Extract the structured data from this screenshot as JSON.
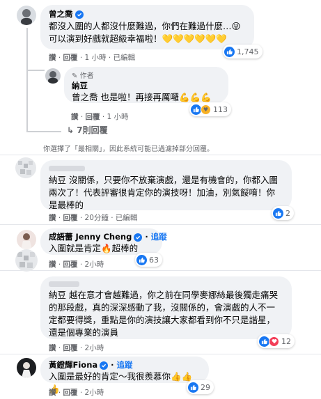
{
  "comments": [
    {
      "author": "曾之喬",
      "text": "都沒入圍的人都沒什麼難過，你們在難過什麼…😜 可以演到好戲就超級幸福啦！💛💛💛💛💛💛",
      "actions": {
        "like": "讚",
        "reply": "回覆",
        "time": "1 小時",
        "edited": "已編輯"
      },
      "reaction_count": "1,745"
    },
    {
      "author_badge": "作者",
      "author": "納豆",
      "text": "曾之喬 也是啦！再接再厲囉💪💪💪",
      "actions": {
        "like": "讚",
        "reply": "回覆",
        "time": "1 小時"
      },
      "reaction_count": "113"
    }
  ],
  "more_replies": "7則回覆",
  "filter_notice": "你選擇了「最相關」，因此系統可能已過濾掉部分回覆。",
  "comment3": {
    "text": "納豆 沒關係，只要你不放棄演戲，還是有機會的，你都入圍兩次了！代表評審很肯定你的演技呀！加油，別氣餒唷！你是最棒的",
    "actions": {
      "like": "讚",
      "reply": "回覆",
      "time": "20分鐘",
      "edited": "已編輯"
    },
    "reaction_count": "2"
  },
  "comment4": {
    "author": "成語蕾 Jenny Cheng",
    "follow": "追蹤",
    "text": "入圍就是肯定🔥超棒的",
    "actions": {
      "like": "讚",
      "reply": "回覆",
      "time": "2小時"
    },
    "reaction_count": "63"
  },
  "comment5": {
    "text": "納豆 越在意才會越難過，你之前在同學麥娜絲最後獨走痛哭的那段戲，真的深深感動了我，沒關係的，會演戲的人不一定都要得獎，重點是你的演技讓大家都看到你不只是諧星，還是個專業的演員",
    "actions": {
      "like": "讚",
      "reply": "回覆",
      "time": "2小時"
    },
    "reaction_count": "12"
  },
  "comment6": {
    "author": "黃鐙輝Fiona",
    "follow": "追蹤",
    "text": "入圍是最好的肯定～我很羨慕你👍👍👍",
    "actions": {
      "like": "讚",
      "reply": "回覆",
      "time": "2小時"
    },
    "reaction_count": "29"
  },
  "colors": {
    "accent": "#1877f2",
    "bubble": "#f0f2f5",
    "meta": "#65676b"
  }
}
